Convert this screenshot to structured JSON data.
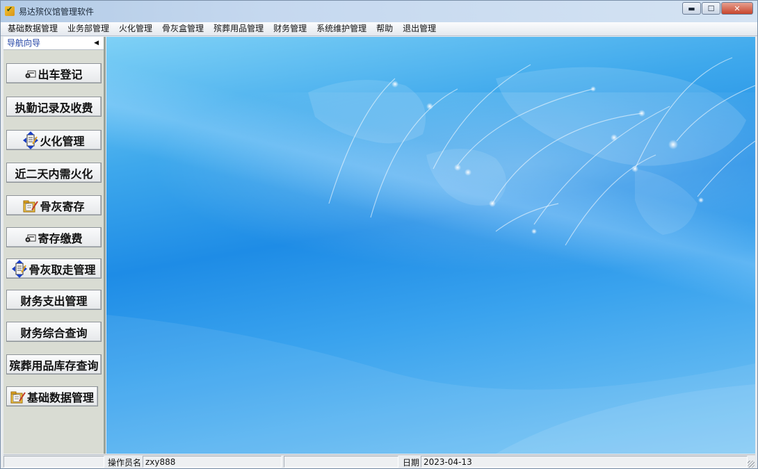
{
  "window": {
    "title": "易达殡仪馆管理软件",
    "controls": {
      "minimize": "▬",
      "maximize": "☐",
      "close": "✕"
    }
  },
  "menu": {
    "items": [
      "基础数据管理",
      "业务部管理",
      "火化管理",
      "骨灰盒管理",
      "殡葬用品管理",
      "财务管理",
      "系统维护管理",
      "帮助",
      "退出管理"
    ]
  },
  "sidebar": {
    "header": "导航向导",
    "collapse_glyph": "◀",
    "buttons": [
      {
        "label": "出车登记",
        "icon": "car-icon"
      },
      {
        "label": "执勤记录及收费",
        "icon": ""
      },
      {
        "label": "火化管理",
        "icon": "arrows-icon"
      },
      {
        "label": "近二天内需火化",
        "icon": ""
      },
      {
        "label": "骨灰寄存",
        "icon": "folder-edit-icon"
      },
      {
        "label": "寄存缴费",
        "icon": "car-icon"
      },
      {
        "label": "骨灰取走管理",
        "icon": "arrows-icon"
      },
      {
        "label": "财务支出管理",
        "icon": ""
      },
      {
        "label": "财务综合查询",
        "icon": ""
      },
      {
        "label": "殡葬用品库存查询",
        "icon": ""
      },
      {
        "label": "基础数据管理",
        "icon": "folder-edit-icon"
      }
    ]
  },
  "status": {
    "operator_label": "操作员名",
    "operator_value": "zxy888",
    "date_label": "日期",
    "date_value": "2023-04-13"
  },
  "colors": {
    "background_blue": "#1e8ce6",
    "nav_header_text": "#1d3fa3"
  }
}
